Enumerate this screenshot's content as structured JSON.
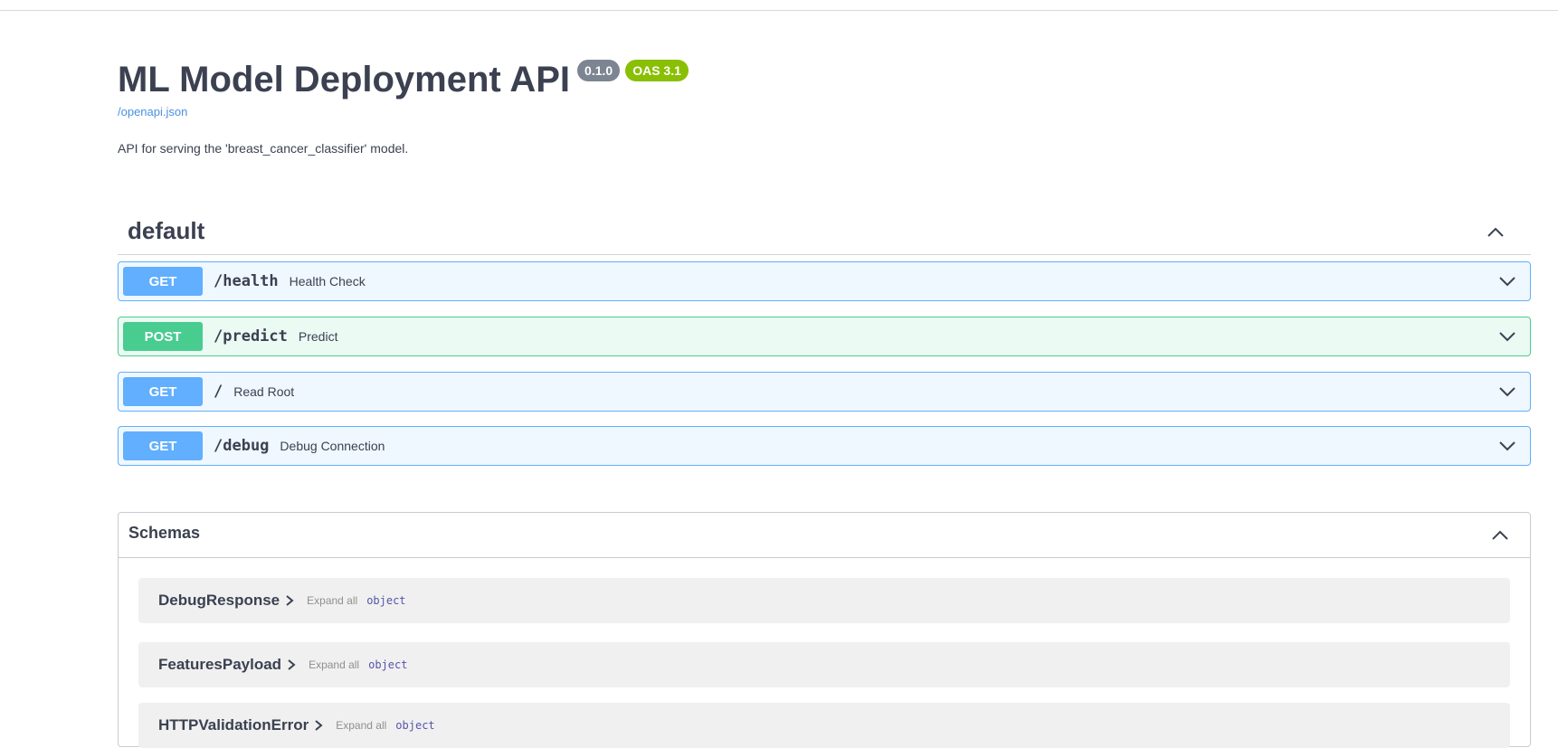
{
  "header": {
    "title": "ML Model Deployment API",
    "version_badge": "0.1.0",
    "oas_badge": "OAS 3.1",
    "spec_link": "/openapi.json",
    "description": "API for serving the 'breast_cancer_classifier' model."
  },
  "tag": {
    "name": "default",
    "toggle_icon": "chevron-up-icon"
  },
  "operations": [
    {
      "method": "GET",
      "path": "/health",
      "summary": "Health Check"
    },
    {
      "method": "POST",
      "path": "/predict",
      "summary": "Predict"
    },
    {
      "method": "GET",
      "path": "/",
      "summary": "Read Root"
    },
    {
      "method": "GET",
      "path": "/debug",
      "summary": "Debug Connection"
    }
  ],
  "schemas": {
    "title": "Schemas",
    "toggle_icon": "chevron-up-icon",
    "models": [
      {
        "name": "DebugResponse",
        "expand_label": "Expand all",
        "type": "object"
      },
      {
        "name": "FeaturesPayload",
        "expand_label": "Expand all",
        "type": "object"
      },
      {
        "name": "HTTPValidationError",
        "expand_label": "Expand all",
        "type": "object"
      }
    ]
  },
  "colors": {
    "get": "#61affe",
    "post": "#49cc90",
    "version_badge": "#7d8492",
    "oas_badge": "#89bf04",
    "link": "#4990e2"
  }
}
